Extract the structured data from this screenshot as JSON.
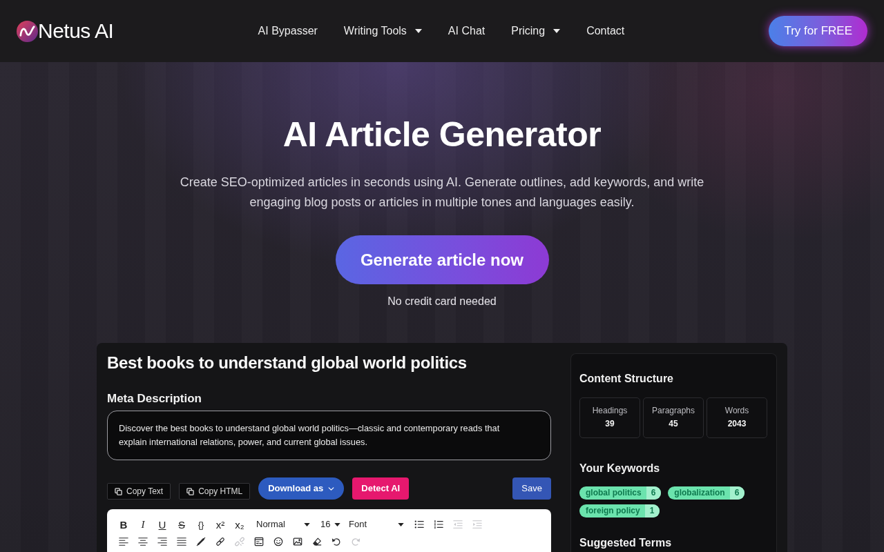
{
  "navbar": {
    "brand": "Netus AI",
    "links": [
      {
        "label": "AI Bypasser",
        "has_menu": false
      },
      {
        "label": "Writing Tools",
        "has_menu": true
      },
      {
        "label": "AI Chat",
        "has_menu": false
      },
      {
        "label": "Pricing",
        "has_menu": true
      },
      {
        "label": "Contact",
        "has_menu": false
      }
    ],
    "cta": "Try for FREE"
  },
  "hero": {
    "title": "AI Article Generator",
    "subtitle": "Create SEO-optimized articles in seconds using AI. Generate outlines, add keywords, and write engaging blog posts or articles in multiple tones and languages easily.",
    "button": "Generate article now",
    "note": "No credit card needed"
  },
  "editor": {
    "title": "Best books to understand global world politics",
    "meta_label": "Meta Description",
    "meta_description": "Discover the best books to understand global world politics—classic and contemporary reads that explain international relations, power, and current global issues.",
    "actions": [
      {
        "kind": "copy",
        "label": "Copy Text"
      },
      {
        "kind": "copy",
        "label": "Copy HTML"
      },
      {
        "kind": "dropdown",
        "label": "Download as"
      },
      {
        "kind": "detect",
        "label": "Detect AI"
      },
      {
        "kind": "save",
        "label": "Save"
      }
    ],
    "toolbar": {
      "rows": [
        {
          "items": [
            {
              "kind": "bold",
              "label": "B",
              "disabled": false
            },
            {
              "kind": "italic",
              "label": "I",
              "disabled": false
            },
            {
              "kind": "underline",
              "label": "U",
              "disabled": false
            },
            {
              "kind": "strike",
              "label": "S",
              "disabled": false
            },
            {
              "kind": "code",
              "label": "{}",
              "disabled": false
            },
            {
              "kind": "superscript",
              "label": "x²",
              "disabled": false
            },
            {
              "kind": "subscript",
              "label": "x₂",
              "disabled": false
            },
            {
              "kind": "select",
              "value": "Normal",
              "disabled": false
            },
            {
              "kind": "select",
              "value": "16",
              "disabled": false
            },
            {
              "kind": "select",
              "value": "Font",
              "disabled": false
            },
            {
              "kind": "bullet-list",
              "disabled": false
            },
            {
              "kind": "numbered-list",
              "disabled": false
            },
            {
              "kind": "outdent",
              "disabled": true
            },
            {
              "kind": "indent",
              "disabled": true
            }
          ]
        },
        {
          "items": [
            {
              "kind": "align-left",
              "disabled": false
            },
            {
              "kind": "align-center",
              "disabled": false
            },
            {
              "kind": "align-right",
              "disabled": false
            },
            {
              "kind": "align-justify",
              "disabled": false
            },
            {
              "kind": "pen",
              "disabled": false
            },
            {
              "kind": "link",
              "disabled": false
            },
            {
              "kind": "unlink",
              "disabled": true
            },
            {
              "kind": "code-block",
              "disabled": false
            },
            {
              "kind": "emoji",
              "disabled": false
            },
            {
              "kind": "image",
              "disabled": false
            },
            {
              "kind": "eraser",
              "disabled": false
            },
            {
              "kind": "undo",
              "disabled": false
            },
            {
              "kind": "redo",
              "disabled": true
            }
          ]
        }
      ]
    }
  },
  "sidebar": {
    "sections": [
      {
        "kind": "stats",
        "title": "Content Structure",
        "stats": [
          {
            "label": "Headings",
            "value": "39"
          },
          {
            "label": "Paragraphs",
            "value": "45"
          },
          {
            "label": "Words",
            "value": "2043"
          }
        ]
      },
      {
        "kind": "keywords",
        "title": "Your Keywords",
        "keywords": [
          {
            "term": "global politics",
            "count": "6"
          },
          {
            "term": "globalization",
            "count": "6"
          },
          {
            "term": "foreign policy",
            "count": "1"
          }
        ]
      },
      {
        "kind": "terms",
        "title": "Suggested Terms"
      }
    ]
  }
}
